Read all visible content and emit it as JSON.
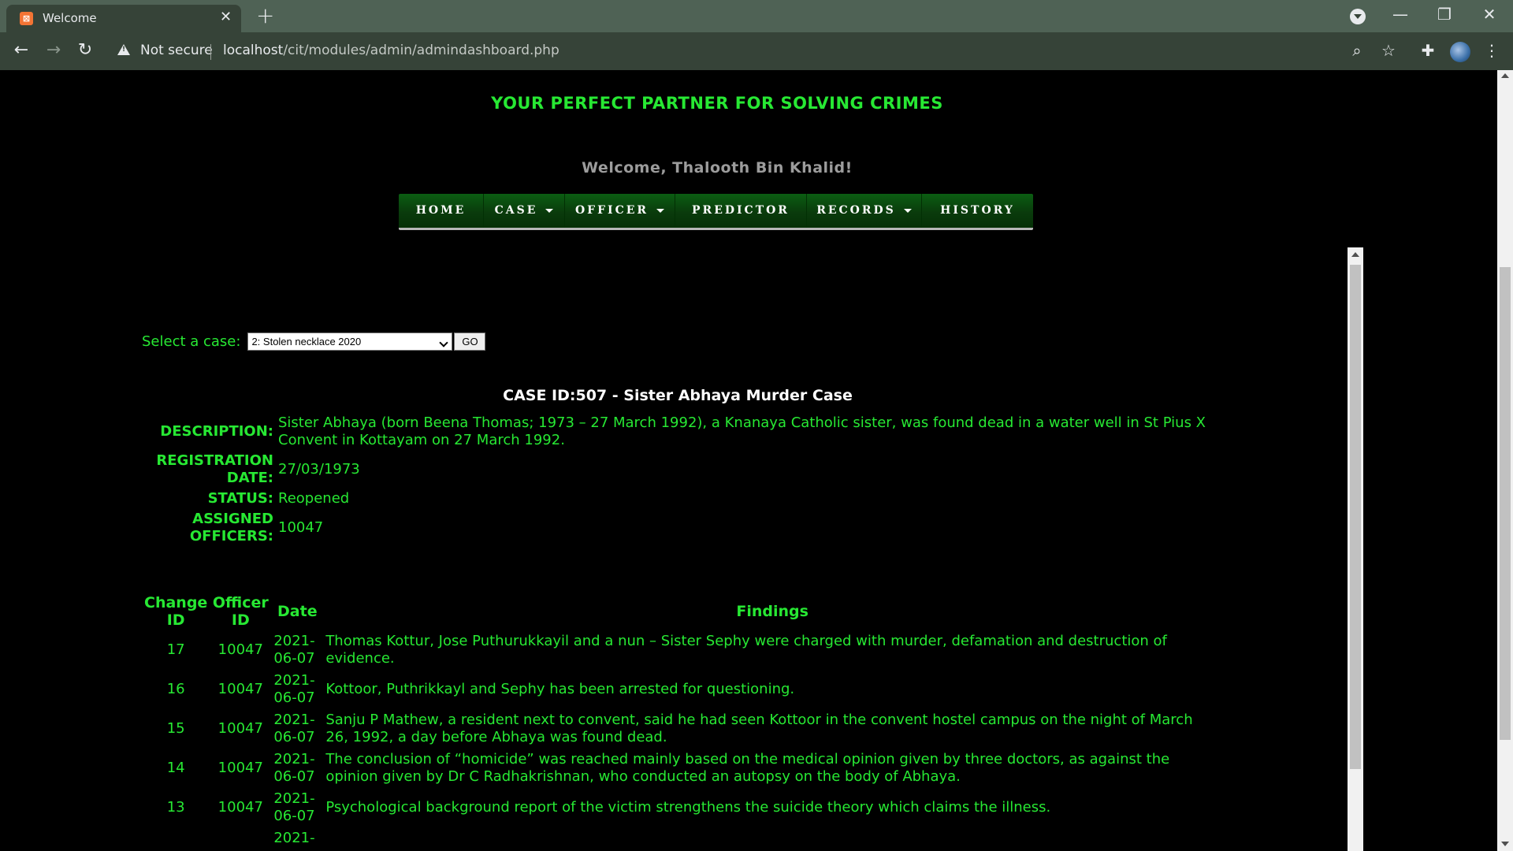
{
  "browser": {
    "tab_title": "Welcome",
    "tab_close": "✕",
    "new_tab": "+",
    "security_label": "Not secure",
    "url_host": "localhost",
    "url_path": "/cit/modules/admin/admindashboard.php",
    "icons": [
      "back-icon",
      "forward-icon",
      "reload-icon",
      "warning-icon",
      "zoom-icon",
      "star-icon",
      "extensions-icon",
      "profile-avatar",
      "menu-icon"
    ]
  },
  "header": {
    "tagline": "YOUR PERFECT PARTNER FOR SOLVING CRIMES",
    "welcome": "Welcome, Thalooth Bin Khalid!"
  },
  "nav": {
    "home": "HOME",
    "case": "CASE",
    "officer": "OFFICER",
    "predictor": "PREDICTOR",
    "records": "RECORDS",
    "history": "HISTORY"
  },
  "selector": {
    "label": "Select a case:",
    "selected": "2: Stolen necklace 2020",
    "go": "GO"
  },
  "case": {
    "title": "CASE ID:507 - Sister Abhaya Murder Case",
    "description_label": "DESCRIPTION:",
    "description": "Sister Abhaya (born Beena Thomas; 1973 – 27 March 1992), a Knanaya Catholic sister, was found dead in a water well in St Pius X Convent in Kottayam on 27 March 1992.",
    "registration_label": "REGISTRATION DATE:",
    "registration": "27/03/1973",
    "status_label": "STATUS:",
    "status": "Reopened",
    "officers_label": "ASSIGNED OFFICERS:",
    "officers": "10047"
  },
  "history": {
    "headers": [
      "Change ID",
      "Officer ID",
      "Date",
      "Findings"
    ],
    "rows": [
      {
        "id": "17",
        "officer": "10047",
        "date": "2021-06-07",
        "findings": "Thomas Kottur, Jose Puthurukkayil and a nun – Sister Sephy were charged with murder, defamation and destruction of evidence."
      },
      {
        "id": "16",
        "officer": "10047",
        "date": "2021-06-07",
        "findings": "Kottoor, Puthrikkayl and Sephy has been arrested for questioning."
      },
      {
        "id": "15",
        "officer": "10047",
        "date": "2021-06-07",
        "findings": "Sanju P Mathew, a resident next to convent, said he had seen Kottoor in the convent hostel campus on the night of March 26, 1992, a day before Abhaya was found dead."
      },
      {
        "id": "14",
        "officer": "10047",
        "date": "2021-06-07",
        "findings": "The conclusion of “homicide” was reached mainly based on the medical opinion given by three doctors, as against the opinion given by Dr C Radhakrishnan, who conducted an autopsy on the body of Abhaya."
      },
      {
        "id": "13",
        "officer": "10047",
        "date": "2021-06-07",
        "findings": "Psychological background report of the victim strengthens the suicide theory which claims the illness."
      },
      {
        "id": "",
        "officer": "",
        "date": "2021-",
        "findings": ""
      }
    ]
  }
}
